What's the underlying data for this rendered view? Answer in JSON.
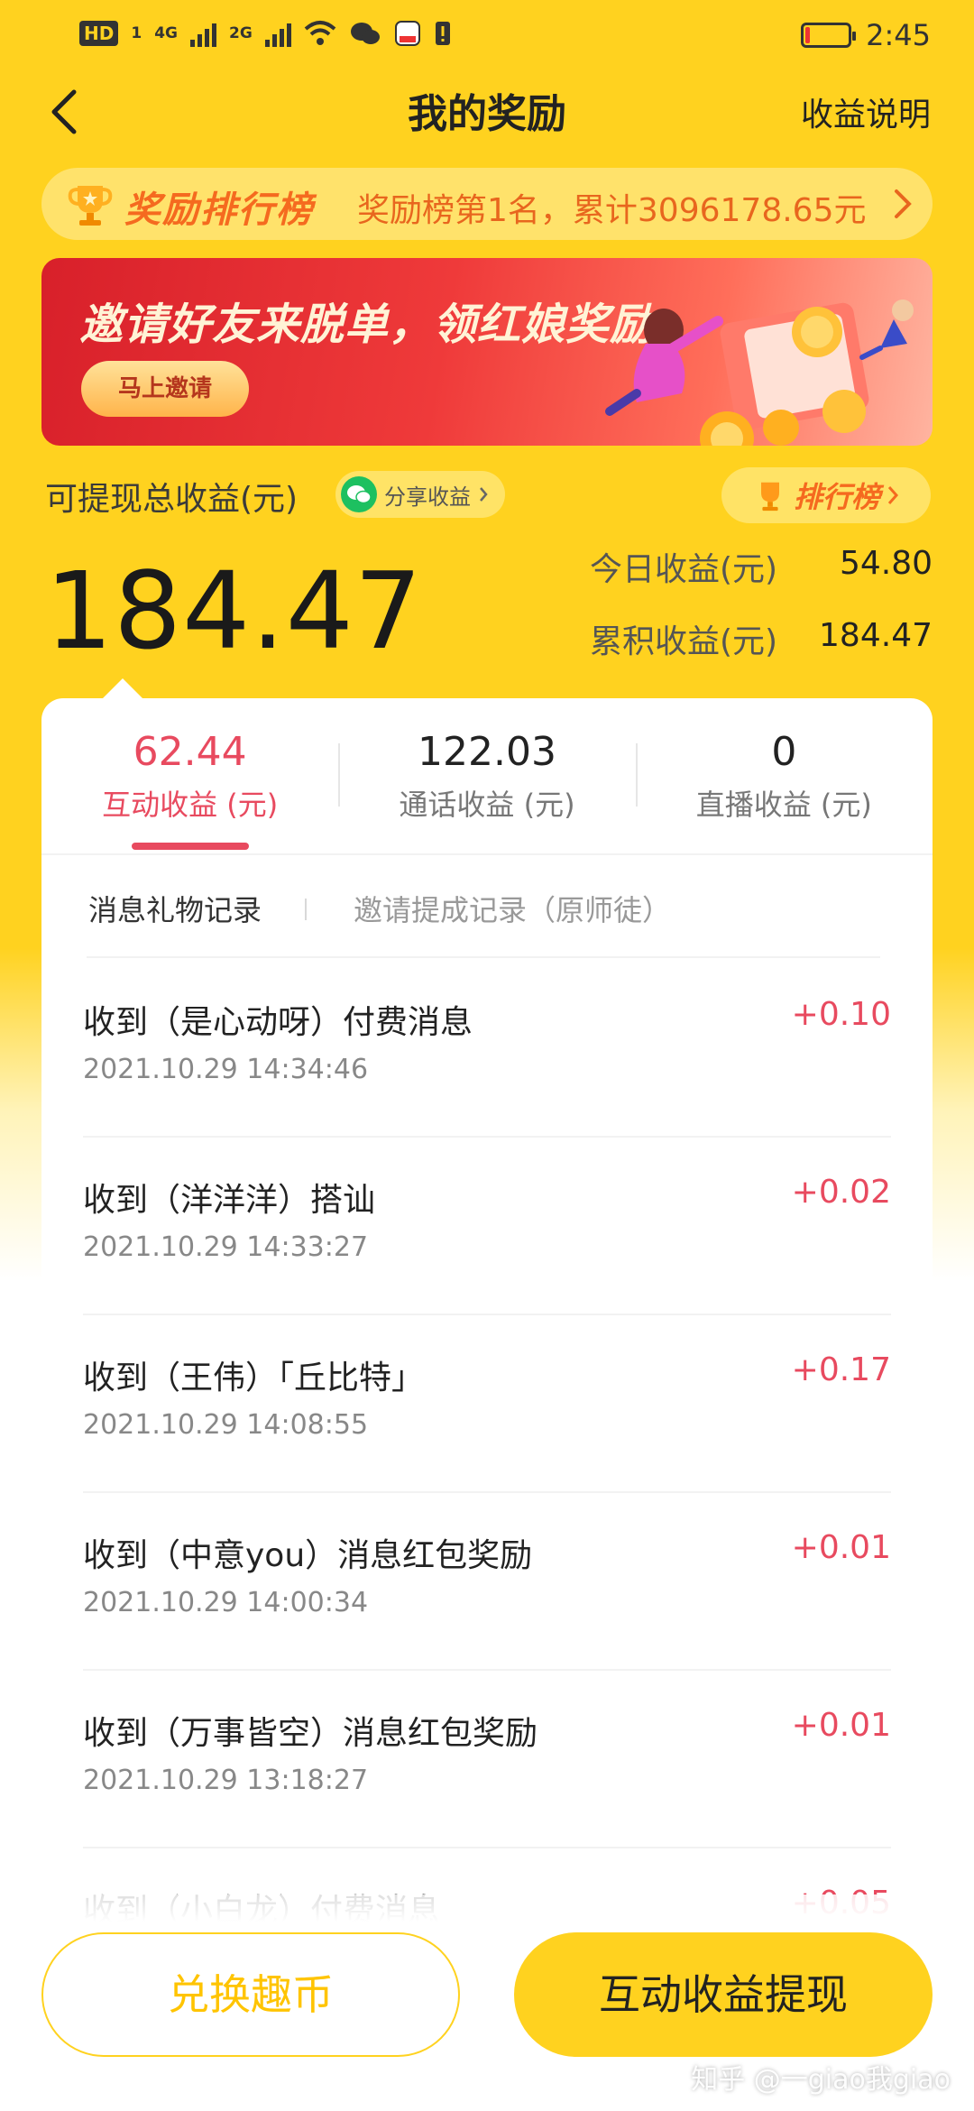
{
  "status_bar": {
    "hd_label": "HD",
    "sim1_label": "1",
    "net1_label": "4G",
    "net2_label": "2G",
    "time": "2:45",
    "battery_level": 0.1
  },
  "header": {
    "title": "我的奖励",
    "right_link": "收益说明"
  },
  "ranking_marquee": {
    "title": "奖励排行榜",
    "text": "奖励榜第1名，累计3096178.65元"
  },
  "banner": {
    "headline": "邀请好友来脱单，领红娘奖励",
    "button": "马上邀请"
  },
  "summary": {
    "withdrawable_label": "可提现总收益(元)",
    "share_chip": "分享收益",
    "rank_chip": "排行榜",
    "withdrawable_total": "184.47",
    "today_label": "今日收益(元)",
    "today_value": "54.80",
    "cumulative_label": "累积收益(元)",
    "cumulative_value": "184.47"
  },
  "stats_tabs": [
    {
      "value": "62.44",
      "label": "互动收益 (元)",
      "active": true
    },
    {
      "value": "122.03",
      "label": "通话收益 (元)",
      "active": false
    },
    {
      "value": "0",
      "label": "直播收益 (元)",
      "active": false
    }
  ],
  "sub_tabs": [
    "消息礼物记录",
    "邀请提成记录（原师徒）"
  ],
  "records": [
    {
      "title": "收到（是心动呀）付费消息",
      "time": "2021.10.29 14:34:46",
      "amount": "+0.10"
    },
    {
      "title": "收到（洋洋洋）搭讪",
      "time": "2021.10.29 14:33:27",
      "amount": "+0.02"
    },
    {
      "title": "收到（王伟）「丘比特」",
      "time": "2021.10.29 14:08:55",
      "amount": "+0.17"
    },
    {
      "title": "收到（中意you）消息红包奖励",
      "time": "2021.10.29 14:00:34",
      "amount": "+0.01"
    },
    {
      "title": "收到（万事皆空）消息红包奖励",
      "time": "2021.10.29 13:18:27",
      "amount": "+0.01"
    },
    {
      "title": "收到（小白龙）付费消息",
      "time": "",
      "amount": "+0.05"
    }
  ],
  "bottom_buttons": {
    "exchange": "兑换趣币",
    "withdraw": "互动收益提现"
  },
  "watermark": "知乎 @一giao我giao",
  "colors": {
    "brand_yellow": "#FFD21F",
    "accent_red": "#E84A5F",
    "rank_orange": "#F56A1F"
  }
}
